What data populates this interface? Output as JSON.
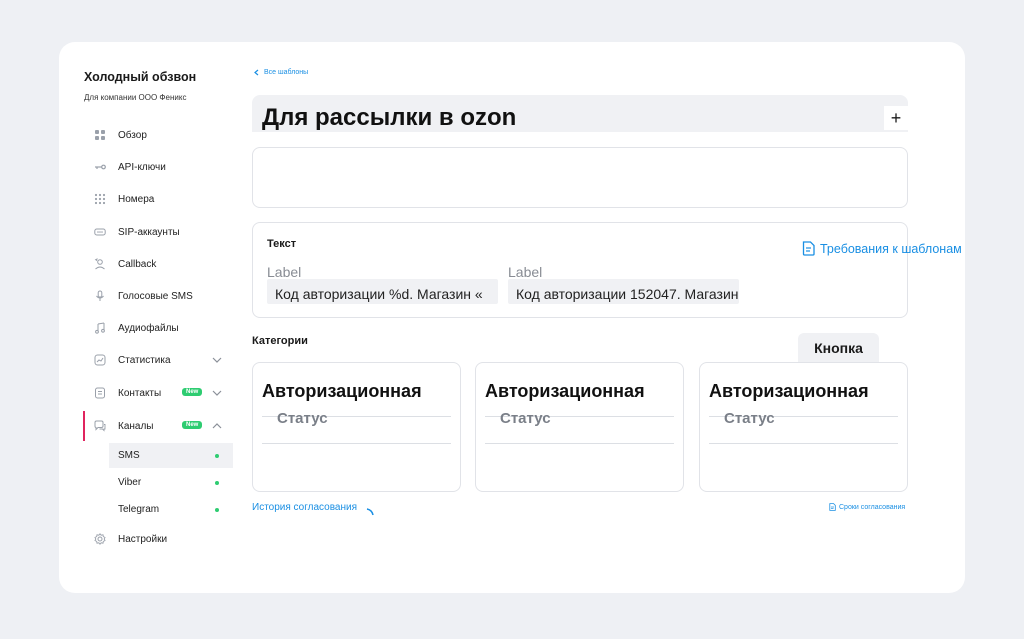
{
  "sidebar": {
    "company_title": "Холодный обзвон",
    "company_subtitle": "Для компании ООО Феникс",
    "items": [
      {
        "label": "Обзор",
        "icon": "grid-icon"
      },
      {
        "label": "API-ключи",
        "icon": "key-icon"
      },
      {
        "label": "Номера",
        "icon": "dialpad-icon"
      },
      {
        "label": "SIP-аккаунты",
        "icon": "sip-icon"
      },
      {
        "label": "Callback",
        "icon": "callback-icon"
      },
      {
        "label": "Голосовые SMS",
        "icon": "microphone-icon"
      },
      {
        "label": "Аудиофайлы",
        "icon": "music-icon"
      },
      {
        "label": "Статистика",
        "icon": "chart-icon"
      },
      {
        "label": "Контакты",
        "icon": "contacts-icon",
        "badge": "New"
      },
      {
        "label": "Каналы",
        "icon": "chat-icon",
        "badge": "New"
      },
      {
        "label": "Настройки",
        "icon": "gear-icon"
      }
    ],
    "channels": [
      {
        "label": "SMS"
      },
      {
        "label": "Viber"
      },
      {
        "label": "Telegram"
      }
    ]
  },
  "main": {
    "back_link": "Все шаблоны",
    "title": "Для рассылки в ozon",
    "plus_label": "+",
    "text_section": {
      "heading": "Текст",
      "requirements_link": "Требования к шаблонам",
      "fields": [
        {
          "label": "Label",
          "value": "Код авторизации %d. Магазин «"
        },
        {
          "label": "Label",
          "value": "Код авторизации 152047. Магазин"
        }
      ]
    },
    "categories": {
      "heading": "Категории",
      "button": "Кнопка",
      "cards": [
        {
          "title": "Авторизационная",
          "status": "Статус"
        },
        {
          "title": "Авторизационная",
          "status": "Статус"
        },
        {
          "title": "Авторизационная",
          "status": "Статус"
        }
      ]
    },
    "history_link": "История согласования",
    "terms_link": "Сроки согласования"
  },
  "colors": {
    "accent": "#1a8fe3",
    "badge_green": "#2ecc71",
    "active_marker": "#e0245e",
    "background": "#eef0f4"
  }
}
